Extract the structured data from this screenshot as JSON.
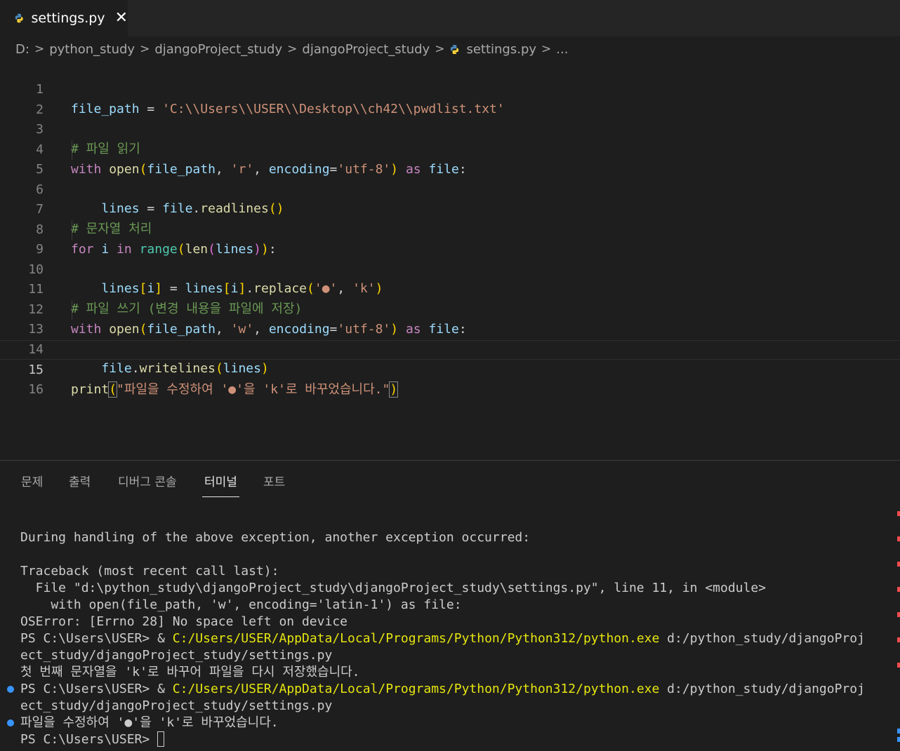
{
  "tab": {
    "title": "settings.py",
    "close": "✕"
  },
  "breadcrumb": [
    "D:",
    "python_study",
    "djangoProject_study",
    "djangoProject_study",
    "settings.py",
    "..."
  ],
  "editor": {
    "line_numbers": [
      "1",
      "2",
      "3",
      "4",
      "5",
      "6",
      "7",
      "8",
      "9",
      "10",
      "11",
      "12",
      "13",
      "14",
      "15",
      "16"
    ],
    "current_line": "15"
  },
  "panel_tabs": [
    "문제",
    "출력",
    "디버그 콘솔",
    "터미널",
    "포트"
  ],
  "active_panel_tab": "터미널",
  "terminal": {
    "lines": [
      "During handling of the above exception, another exception occurred:",
      "",
      "Traceback (most recent call last):",
      "  File \"d:\\python_study\\djangoProject_study\\djangoProject_study\\settings.py\", line 11, in <module>",
      "    with open(file_path, 'w', encoding='latin-1') as file:",
      "OSError: [Errno 28] No space left on device"
    ],
    "prompt": "PS C:\\Users\\USER> ",
    "amp": "& ",
    "exe": "C:/Users/USER/AppData/Local/Programs/Python/Python312/python.exe",
    "arg1": " d:/python_study/djangoProj",
    "arg2": "ect_study/djangoProject_study/settings.py",
    "out1": "첫 번째 문자열을 'k'로 바꾸어 파일을 다시 저장했습니다.",
    "out2": "파일을 수정하여 '●'을 'k'로 바꾸었습니다."
  },
  "colors": {
    "background": "#1e1e1e",
    "keyword": "#c586c0",
    "string": "#ce9178",
    "comment": "#6a9955",
    "variable": "#9cdcfe",
    "function": "#dcdcaa",
    "exe_path": "#e5e510"
  },
  "icons": [
    "python-file-icon",
    "close-icon",
    "chevron-right-icon"
  ]
}
